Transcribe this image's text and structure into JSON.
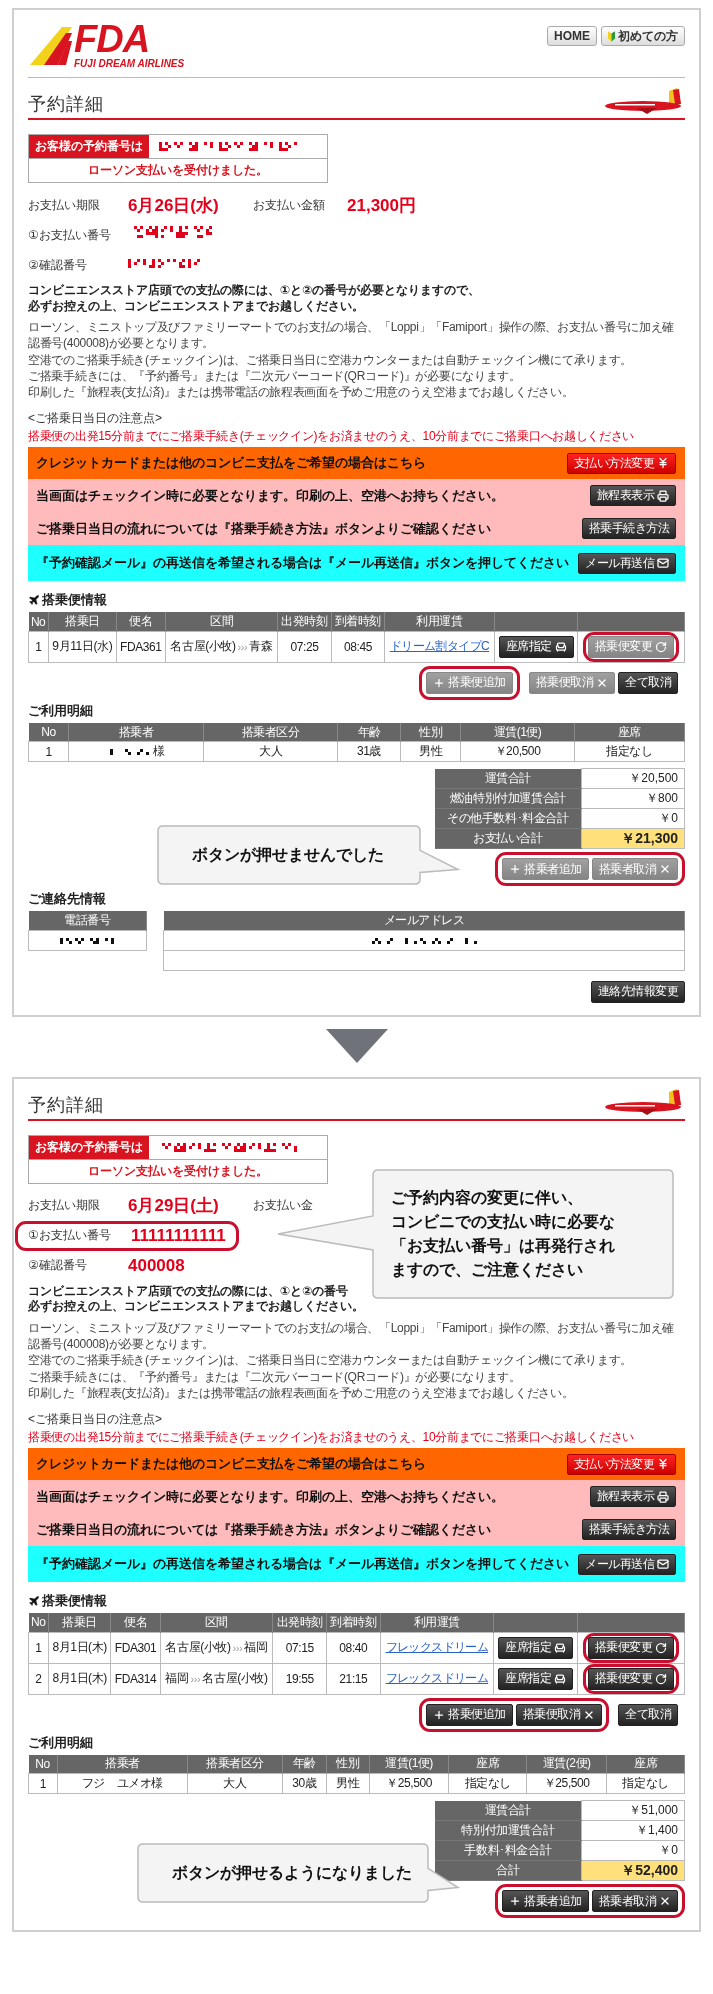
{
  "panels": [
    {
      "header": {
        "logo": {
          "mark": "FDA",
          "tagline": "FUJI DREAM AIRLINES"
        },
        "nav": [
          {
            "label": "HOME",
            "kind": "home"
          },
          {
            "label": "初めての方",
            "kind": "beginner"
          }
        ]
      },
      "title": "予約詳細",
      "reservation": {
        "label": "お客様の予約番号は",
        "number": {
          "kind": "mosaic"
        },
        "status": "ローソン支払いを受付けました。"
      },
      "payment": {
        "deadline_label": "お支払い期限",
        "deadline": "6月26日(水)",
        "amount_label": "お支払い金額",
        "amount": "21,300円",
        "number_label": "①お支払い番号",
        "number": {
          "kind": "mosaic"
        },
        "number_ringed": false,
        "confirm_label": "②確認番号",
        "confirm": {
          "kind": "mosaic"
        }
      },
      "notice_bold": [
        "コンビニエンスストア店頭での支払の際には、①と②の番号が必要となりますので、",
        "必ずお控えの上、コンビニエンスストアまでお越しください。"
      ],
      "notes": [
        "ローソン、ミニストップ及びファミリーマートでのお支払の場合、「Loppi」「Famiport」操作の際、お支払い番号に加え確認番号(400008)が必要となります。",
        "空港でのご搭乗手続き(チェックイン)は、ご搭乗日当日に空港カウンターまたは自動チェックイン機にて承ります。",
        "ご搭乗手続きには、『予約番号』または『二次元バーコード(QRコード)』が必要になります。",
        "印刷した『旅程表(支払済)』または携帯電話の旅程表画面を予めご用意のうえ空港までお越しください。"
      ],
      "boarding_note_title": "<ご搭乗日当日の注意点>",
      "boarding_note": "搭乗便の出発15分前までにご搭乗手続き(チェックイン)をお済ませのうえ、10分前までにご搭乗口へお越しください",
      "banners": [
        {
          "color": "#ff6600",
          "text": "クレジットカードまたは他のコンビニ支払をご希望の場合はこちら",
          "button": {
            "label": "支払い方法変更",
            "kind": "change-payment"
          }
        },
        {
          "color": "#ffbbbb",
          "text": "当画面はチェックイン時に必要となります。印刷の上、空港へお持ちください。",
          "button": {
            "label": "旅程表表示",
            "kind": "itinerary"
          }
        },
        {
          "color": "#ffbbbb",
          "text": "ご搭乗日当日の流れについては『搭乗手続き方法』ボタンよりご確認ください",
          "button": {
            "label": "搭乗手続き方法",
            "kind": "procedure"
          }
        },
        {
          "color": "#1effff",
          "text": "『予約確認メール』の再送信を希望される場合は『メール再送信』ボタンを押してください",
          "button": {
            "label": "メール再送信",
            "kind": "resend"
          }
        }
      ],
      "flights": {
        "title": "搭乗便情報",
        "columns": [
          "No",
          "搭乗日",
          "便名",
          "区間",
          "出発時刻",
          "到着時刻",
          "利用運賃"
        ],
        "rows": [
          {
            "no": "1",
            "date": "9月11日(水)",
            "flight": "FDA361",
            "from": "名古屋(小牧)",
            "sep": "›››",
            "to": "青森",
            "dep": "07:25",
            "arr": "08:45",
            "fare": "ドリーム割タイプC",
            "seat_button": {
              "label": "座席指定",
              "disabled": false
            },
            "change_button": {
              "label": "搭乗便変更",
              "disabled": true,
              "ringed": true
            }
          }
        ],
        "actions": [
          {
            "ringed": true,
            "buttons": [
              {
                "label": "搭乗便追加",
                "kind": "add",
                "disabled": true
              }
            ]
          },
          {
            "ringed": false,
            "buttons": [
              {
                "label": "搭乗便取消",
                "kind": "cancel",
                "disabled": true
              },
              {
                "label": "全て取消",
                "kind": "cancel-all",
                "disabled": false
              }
            ]
          }
        ]
      },
      "usage": {
        "title": "ご利用明細",
        "columns": [
          "No",
          "搭乗者",
          "搭乗者区分",
          "年齢",
          "性別",
          "運賃(1便)",
          "座席"
        ],
        "rows": [
          [
            {
              "kind": "text",
              "text": "1"
            },
            {
              "kind": "mosaic",
              "suffix": "様"
            },
            {
              "kind": "text",
              "text": "大人"
            },
            {
              "kind": "text",
              "text": "31歳"
            },
            {
              "kind": "text",
              "text": "男性"
            },
            {
              "kind": "text",
              "text": "￥20,500"
            },
            {
              "kind": "text",
              "text": "指定なし"
            }
          ]
        ],
        "totals": [
          {
            "label": "運賃合計",
            "value": "￥20,500",
            "emphasis": false
          },
          {
            "label": "燃油特別付加運賃合計",
            "value": "￥800",
            "emphasis": false
          },
          {
            "label": "その他手数料･料金合計",
            "value": "￥0",
            "emphasis": false
          },
          {
            "label": "お支払い合計",
            "value": "￥21,300",
            "emphasis": true
          }
        ],
        "callout": "ボタンが押せませんでした",
        "actions": [
          {
            "ringed": true,
            "buttons": [
              {
                "label": "搭乗者追加",
                "kind": "add",
                "disabled": true
              },
              {
                "label": "搭乗者取消",
                "kind": "cancel",
                "disabled": true
              }
            ]
          }
        ]
      },
      "contact": {
        "title": "ご連絡先情報",
        "phone_label": "電話番号",
        "email_label": "メールアドレス",
        "button": "連絡先情報変更"
      }
    },
    {
      "title": "予約詳細",
      "reservation": {
        "label": "お客様の予約番号は",
        "number": {
          "kind": "mosaic"
        },
        "status": "ローソン支払いを受付けました。"
      },
      "payment": {
        "deadline_label": "お支払い期限",
        "deadline": "6月29日(土)",
        "amount_label": "お支払い金",
        "number_label": "①お支払い番号",
        "number": {
          "kind": "text",
          "text": "11111111111"
        },
        "number_ringed": true,
        "confirm_label": "②確認番号",
        "confirm": {
          "kind": "text",
          "text": "400008"
        },
        "callout": [
          "ご予約内容の変更に伴い、",
          "コンビニでの支払い時に必要な",
          "「お支払い番号」は再発行され",
          "ますので、ご注意ください"
        ]
      },
      "notice_bold": [
        "コンビニエンスストア店頭での支払の際には、①と②の番号",
        "必ずお控えの上、コンビニエンスストアまでお越しください。"
      ],
      "notes": [
        "ローソン、ミニストップ及びファミリーマートでのお支払の場合、「Loppi」「Famiport」操作の際、お支払い番号に加え確認番号(400008)が必要となります。",
        "空港でのご搭乗手続き(チェックイン)は、ご搭乗日当日に空港カウンターまたは自動チェックイン機にて承ります。",
        "ご搭乗手続きには、『予約番号』または『二次元バーコード(QRコード)』が必要になります。",
        "印刷した『旅程表(支払済)』または携帯電話の旅程表画面を予めご用意のうえ空港までお越しください。"
      ],
      "boarding_note_title": "<ご搭乗日当日の注意点>",
      "boarding_note": "搭乗便の出発15分前までにご搭乗手続き(チェックイン)をお済ませのうえ、10分前までにご搭乗口へお越しください",
      "banners": [
        {
          "color": "#ff6600",
          "text": "クレジットカードまたは他のコンビニ支払をご希望の場合はこちら",
          "button": {
            "label": "支払い方法変更",
            "kind": "change-payment"
          }
        },
        {
          "color": "#ffbbbb",
          "text": "当画面はチェックイン時に必要となります。印刷の上、空港へお持ちください。",
          "button": {
            "label": "旅程表表示",
            "kind": "itinerary"
          }
        },
        {
          "color": "#ffbbbb",
          "text": "ご搭乗日当日の流れについては『搭乗手続き方法』ボタンよりご確認ください",
          "button": {
            "label": "搭乗手続き方法",
            "kind": "procedure"
          }
        },
        {
          "color": "#1effff",
          "text": "『予約確認メール』の再送信を希望される場合は『メール再送信』ボタンを押してください",
          "button": {
            "label": "メール再送信",
            "kind": "resend"
          }
        }
      ],
      "flights": {
        "title": "搭乗便情報",
        "columns": [
          "No",
          "搭乗日",
          "便名",
          "区間",
          "出発時刻",
          "到着時刻",
          "利用運賃"
        ],
        "rows": [
          {
            "no": "1",
            "date": "8月1日(木)",
            "flight": "FDA301",
            "from": "名古屋(小牧)",
            "sep": "›››",
            "to": "福岡",
            "dep": "07:15",
            "arr": "08:40",
            "fare": "フレックスドリーム",
            "seat_button": {
              "label": "座席指定",
              "disabled": false
            },
            "change_button": {
              "label": "搭乗便変更",
              "disabled": false,
              "ringed": true
            }
          },
          {
            "no": "2",
            "date": "8月1日(木)",
            "flight": "FDA314",
            "from": "福岡",
            "sep": "›››",
            "to": "名古屋(小牧)",
            "dep": "19:55",
            "arr": "21:15",
            "fare": "フレックスドリーム",
            "seat_button": {
              "label": "座席指定",
              "disabled": false
            },
            "change_button": {
              "label": "搭乗便変更",
              "disabled": false,
              "ringed": true
            }
          }
        ],
        "actions": [
          {
            "ringed": true,
            "buttons": [
              {
                "label": "搭乗便追加",
                "kind": "add",
                "disabled": false
              },
              {
                "label": "搭乗便取消",
                "kind": "cancel",
                "disabled": false
              }
            ]
          },
          {
            "ringed": false,
            "buttons": [
              {
                "label": "全て取消",
                "kind": "cancel-all",
                "disabled": false
              }
            ]
          }
        ]
      },
      "usage": {
        "title": "ご利用明細",
        "columns": [
          "No",
          "搭乗者",
          "搭乗者区分",
          "年齢",
          "性別",
          "運賃(1便)",
          "座席",
          "運賃(2便)",
          "座席"
        ],
        "rows": [
          [
            {
              "kind": "text",
              "text": "1"
            },
            {
              "kind": "text",
              "text": "フジ　ユメオ様"
            },
            {
              "kind": "text",
              "text": "大人"
            },
            {
              "kind": "text",
              "text": "30歳"
            },
            {
              "kind": "text",
              "text": "男性"
            },
            {
              "kind": "text",
              "text": "￥25,500"
            },
            {
              "kind": "text",
              "text": "指定なし"
            },
            {
              "kind": "text",
              "text": "￥25,500"
            },
            {
              "kind": "text",
              "text": "指定なし"
            }
          ]
        ],
        "totals": [
          {
            "label": "運賃合計",
            "value": "￥51,000",
            "emphasis": false
          },
          {
            "label": "特別付加運賃合計",
            "value": "￥1,400",
            "emphasis": false
          },
          {
            "label": "手数料･料金合計",
            "value": "￥0",
            "emphasis": false
          },
          {
            "label": "合計",
            "value": "￥52,400",
            "emphasis": true
          }
        ],
        "callout": "ボタンが押せるようになりました",
        "actions": [
          {
            "ringed": true,
            "buttons": [
              {
                "label": "搭乗者追加",
                "kind": "add",
                "disabled": false
              },
              {
                "label": "搭乗者取消",
                "kind": "cancel",
                "disabled": false
              }
            ]
          }
        ]
      }
    }
  ]
}
